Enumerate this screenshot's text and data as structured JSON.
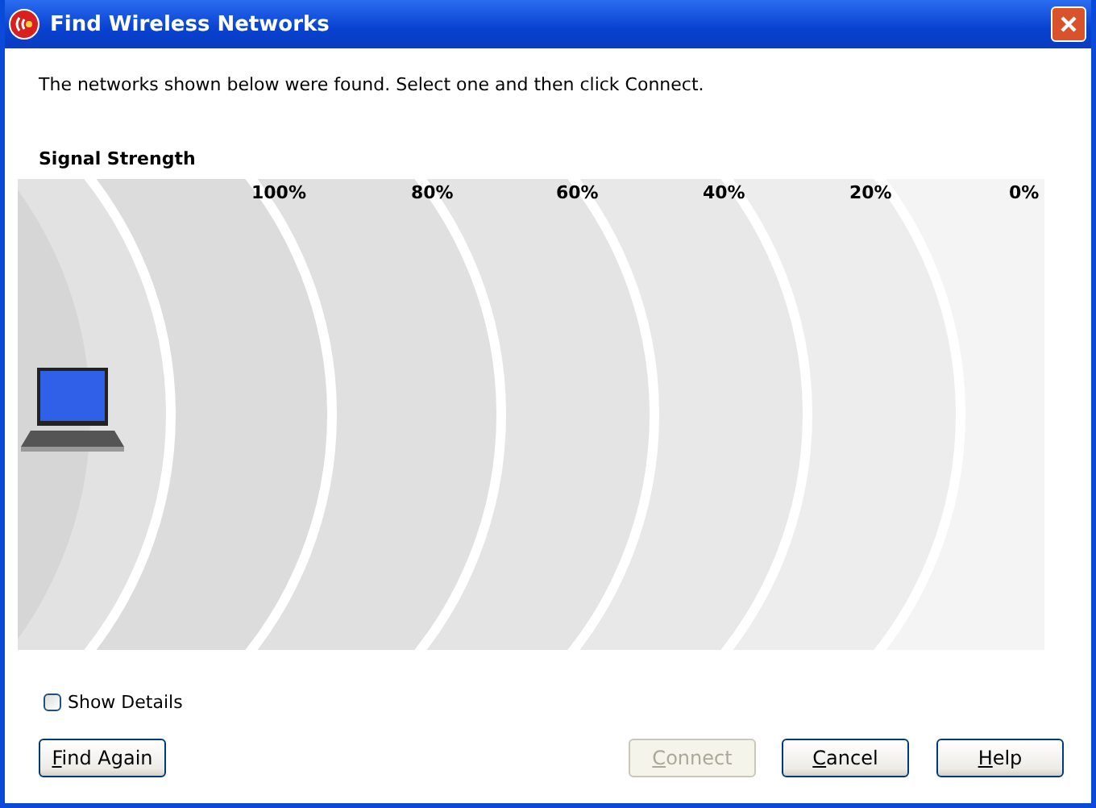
{
  "window": {
    "title": "Find Wireless Networks"
  },
  "instruction": "The networks shown below were found. Select one and then click Connect.",
  "signal": {
    "title": "Signal Strength",
    "scale_labels": [
      "100%",
      "80%",
      "60%",
      "40%",
      "20%",
      "0%"
    ]
  },
  "show_details": {
    "label": "Show Details",
    "checked": false
  },
  "buttons": [
    {
      "label": "Find Again",
      "disabled": false
    },
    {
      "label": "Connect",
      "disabled": true
    },
    {
      "label": "Cancel",
      "disabled": false
    },
    {
      "label": "Help",
      "disabled": false
    }
  ]
}
